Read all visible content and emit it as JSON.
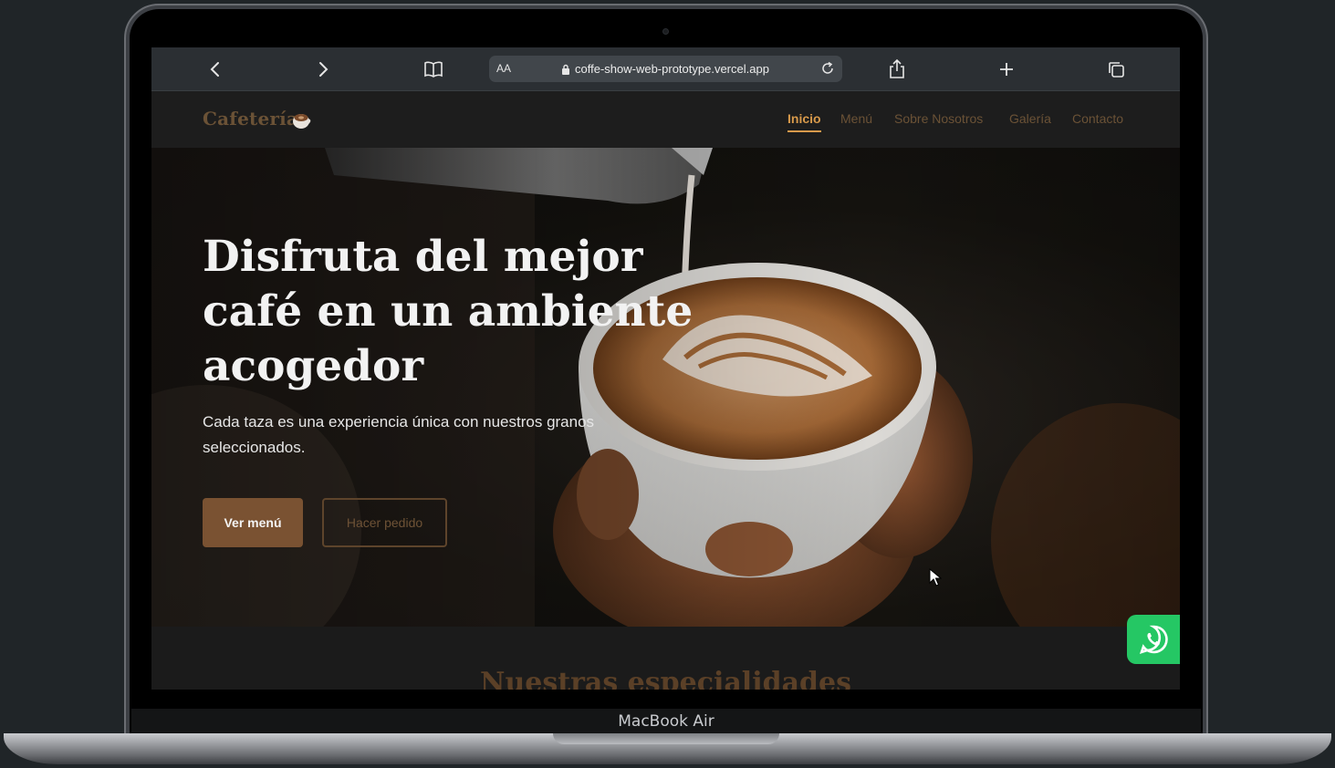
{
  "browser": {
    "aa_label": "AA",
    "url": "coffe-show-web-prototype.vercel.app",
    "icons": [
      "back-icon",
      "forward-icon",
      "bookmarks-icon",
      "lock-icon",
      "reload-icon",
      "share-icon",
      "new-tab-icon",
      "tabs-icon"
    ]
  },
  "device": {
    "label": "MacBook Air"
  },
  "site": {
    "logo": "Cafetería",
    "logo_icon": "coffee-cup-icon",
    "nav": [
      {
        "label": "Inicio",
        "active": true
      },
      {
        "label": "Menú",
        "active": false
      },
      {
        "label": "Sobre Nosotros",
        "active": false
      },
      {
        "label": "Galería",
        "active": false
      },
      {
        "label": "Contacto",
        "active": false
      }
    ],
    "hero": {
      "title": "Disfruta del mejor café en un ambiente acogedor",
      "subtitle": "Cada taza es una experiencia única con nuestros granos seleccionados.",
      "primary_button": "Ver menú",
      "secondary_button": "Hacer pedido"
    },
    "section_title": "Nuestras especialidades",
    "whatsapp_icon": "whatsapp-icon"
  },
  "colors": {
    "accent": "#d89a4b",
    "brand_brown": "#7a5232",
    "whatsapp_green": "#25c764"
  }
}
